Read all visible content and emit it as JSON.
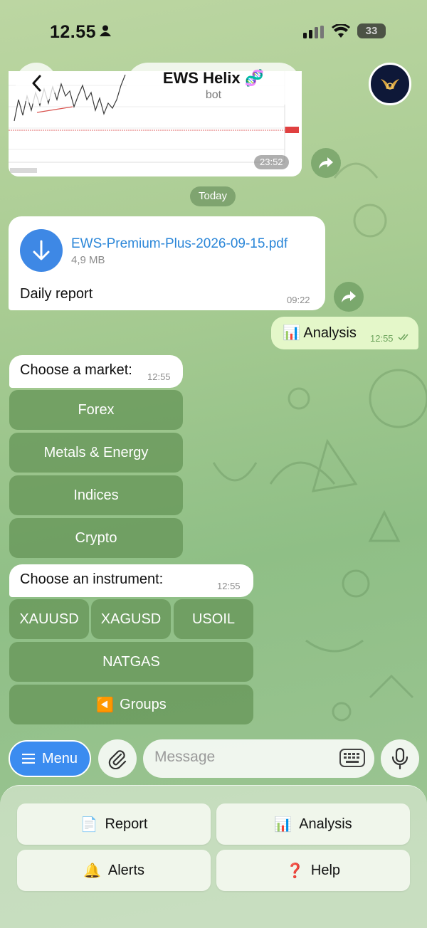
{
  "status_bar": {
    "time": "12.55",
    "battery": "33"
  },
  "header": {
    "title": "EWS Helix 🧬",
    "subtitle": "bot"
  },
  "chart_message": {
    "time": "23:52"
  },
  "date_divider": "Today",
  "document_message": {
    "file_name": "EWS-Premium-Plus-2026-09-15.pdf",
    "file_size": "4,9 MB",
    "caption": "Daily report",
    "time": "09:22"
  },
  "outgoing_message": {
    "icon": "📊",
    "text": "Analysis",
    "time": "12:55"
  },
  "market_prompt": {
    "text": "Choose a market:",
    "time": "12:55"
  },
  "market_buttons": [
    "Forex",
    "Metals & Energy",
    "Indices",
    "Crypto"
  ],
  "instrument_prompt": {
    "text": "Choose an instrument:",
    "time": "12:55"
  },
  "instrument_buttons": [
    "XAUUSD",
    "XAGUSD",
    "USOIL"
  ],
  "instrument_wide_button": "NATGAS",
  "groups_button": {
    "icon": "◀️",
    "label": "Groups"
  },
  "input_bar": {
    "menu_label": "Menu",
    "placeholder": "Message"
  },
  "reply_keyboard": [
    {
      "icon": "📄",
      "label": "Report"
    },
    {
      "icon": "📊",
      "label": "Analysis"
    },
    {
      "icon": "🔔",
      "label": "Alerts"
    },
    {
      "icon": "❓",
      "label": "Help"
    }
  ],
  "colors": {
    "accent": "#3b8cf0",
    "bot_button": "#66964f",
    "outgoing_bubble": "#e4f7c9",
    "link": "#2a86d8"
  }
}
